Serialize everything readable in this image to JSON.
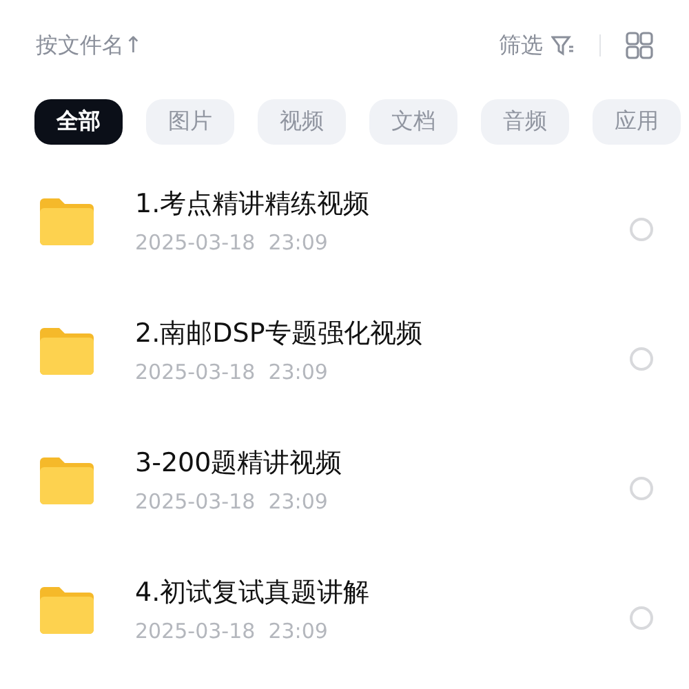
{
  "toolbar": {
    "sort_label": "按文件名↑",
    "filter_label": "筛选"
  },
  "tabs": [
    {
      "label": "全部",
      "selected": true
    },
    {
      "label": "图片",
      "selected": false
    },
    {
      "label": "视频",
      "selected": false
    },
    {
      "label": "文档",
      "selected": false
    },
    {
      "label": "音频",
      "selected": false
    },
    {
      "label": "应用",
      "selected": false
    }
  ],
  "files": [
    {
      "name": "1.考点精讲精练视频",
      "date": "2025-03-18  23:09",
      "selected": false
    },
    {
      "name": "2.南邮DSP专题强化视频",
      "date": "2025-03-18  23:09",
      "selected": false
    },
    {
      "name": "3-200题精讲视频",
      "date": "2025-03-18  23:09",
      "selected": false
    },
    {
      "name": "4.初试复试真题讲解",
      "date": "2025-03-18  23:09",
      "selected": false
    }
  ]
}
